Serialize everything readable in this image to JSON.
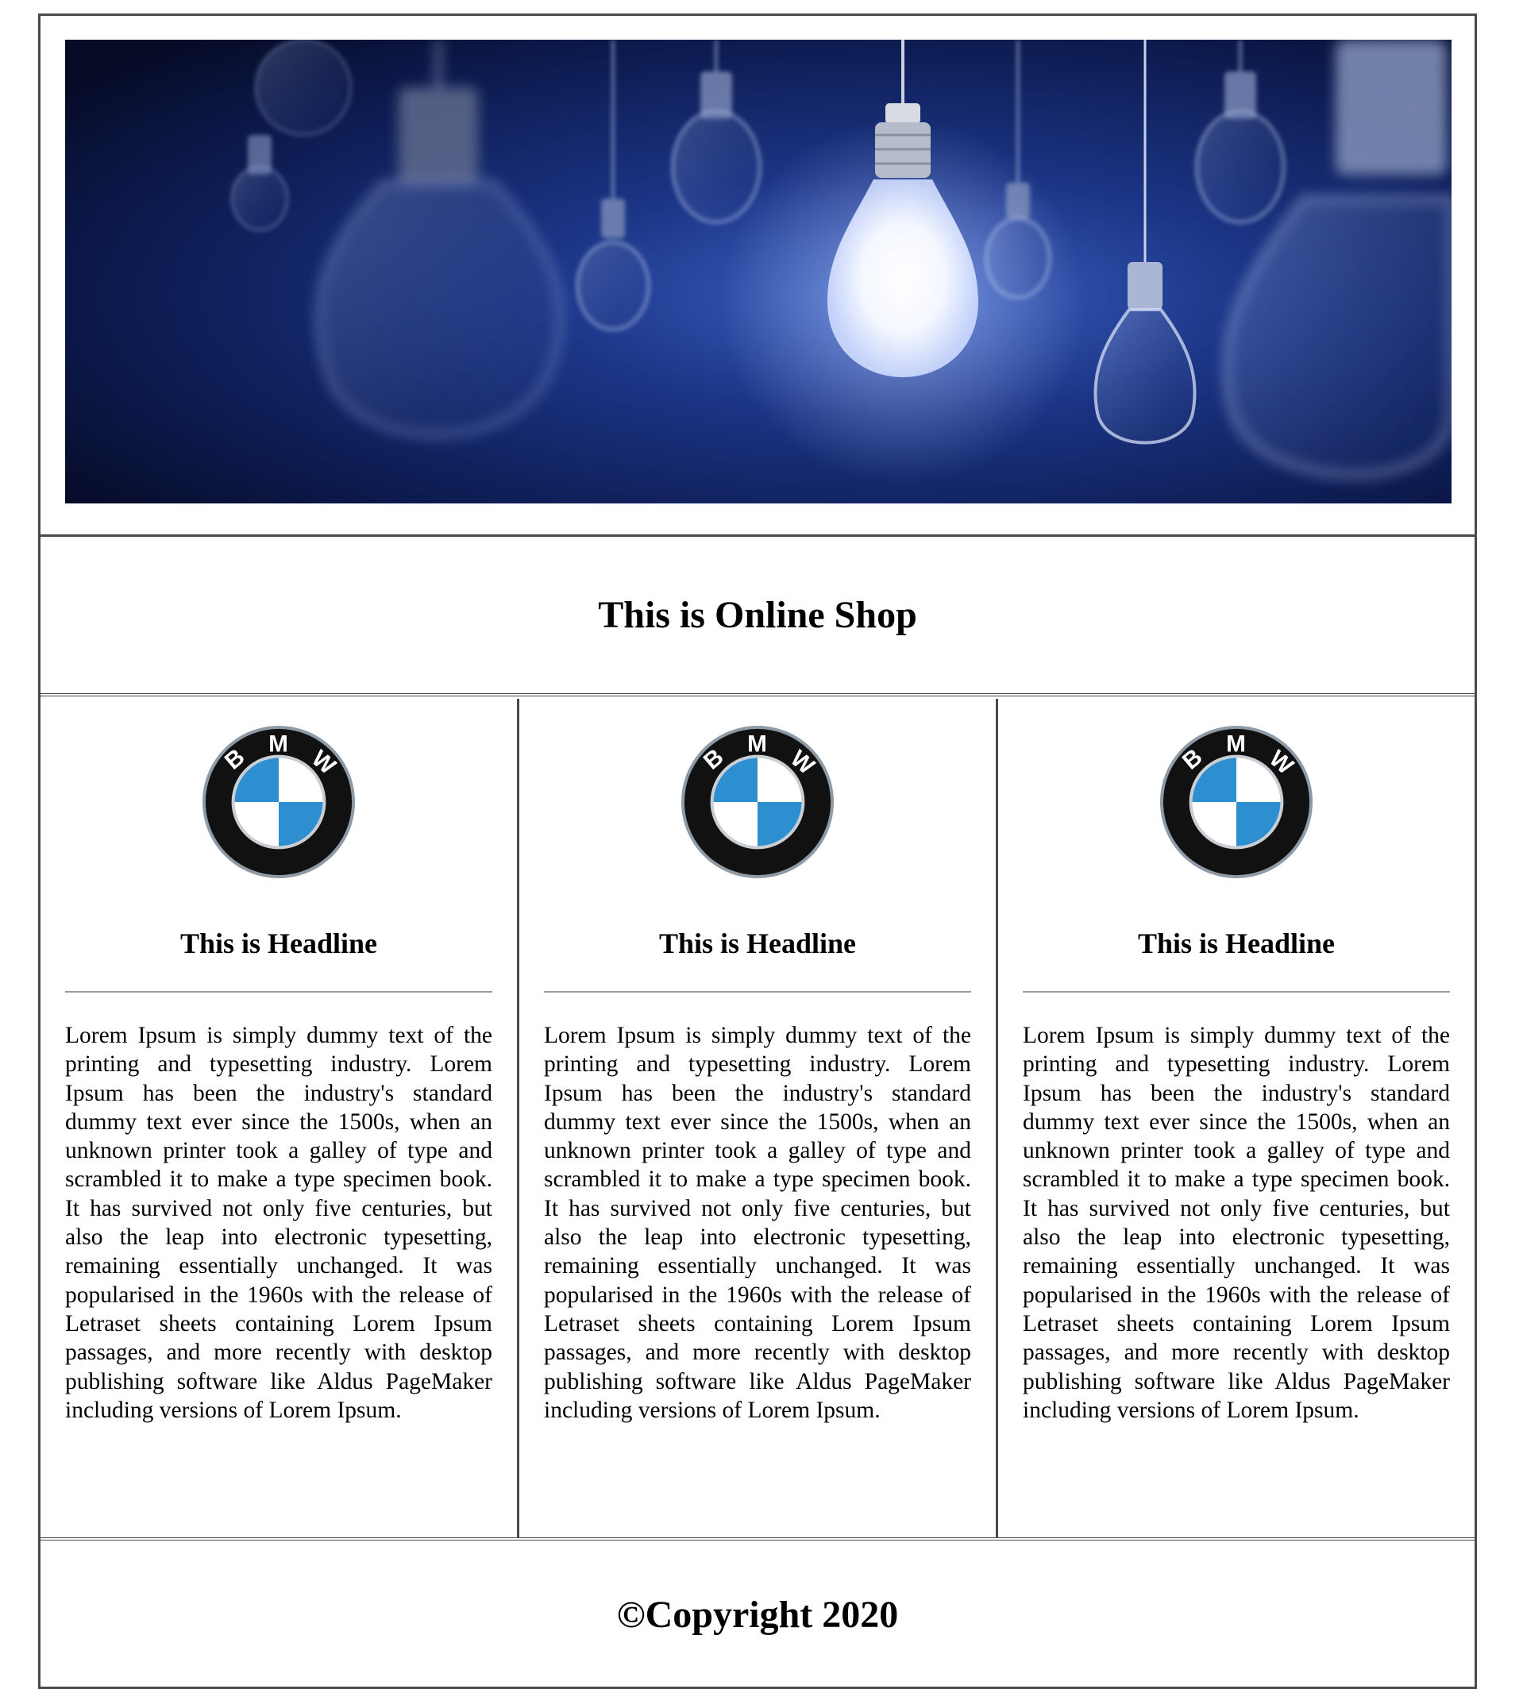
{
  "header": {
    "banner_image": "hanging-light-bulbs-banner"
  },
  "shop": {
    "title": "This is Online Shop"
  },
  "cards": [
    {
      "logo": "bmw-logo",
      "logo_letters": [
        "B",
        "M",
        "W"
      ],
      "headline": "This is Headline",
      "body": "Lorem Ipsum is simply dummy text of the printing and typesetting industry. Lorem Ipsum has been the industry's standard dummy text ever since the 1500s, when an unknown printer took a galley of type and scrambled it to make a type specimen book. It has survived not only five centuries, but also the leap into electronic typesetting, remaining essentially unchanged. It was popularised in the 1960s with the release of Letraset sheets containing Lorem Ipsum passages, and more recently with desktop publishing software like Aldus PageMaker including versions of Lorem Ipsum."
    },
    {
      "logo": "bmw-logo",
      "logo_letters": [
        "B",
        "M",
        "W"
      ],
      "headline": "This is Headline",
      "body": "Lorem Ipsum is simply dummy text of the printing and typesetting industry. Lorem Ipsum has been the industry's standard dummy text ever since the 1500s, when an unknown printer took a galley of type and scrambled it to make a type specimen book. It has survived not only five centuries, but also the leap into electronic typesetting, remaining essentially unchanged. It was popularised in the 1960s with the release of Letraset sheets containing Lorem Ipsum passages, and more recently with desktop publishing software like Aldus PageMaker including versions of Lorem Ipsum."
    },
    {
      "logo": "bmw-logo",
      "logo_letters": [
        "B",
        "M",
        "W"
      ],
      "headline": "This is Headline",
      "body": "Lorem Ipsum is simply dummy text of the printing and typesetting industry. Lorem Ipsum has been the industry's standard dummy text ever since the 1500s, when an unknown printer took a galley of type and scrambled it to make a type specimen book. It has survived not only five centuries, but also the leap into electronic typesetting, remaining essentially unchanged. It was popularised in the 1960s with the release of Letraset sheets containing Lorem Ipsum passages, and more recently with desktop publishing software like Aldus PageMaker including versions of Lorem Ipsum."
    }
  ],
  "footer": {
    "copyright": "©Copyright 2020"
  },
  "colors": {
    "border": "#4a4a4a",
    "divider": "#9a9a9a",
    "banner_dark": "#0b1436",
    "banner_mid": "#1f3a8a",
    "bmw_blue": "#2e8fd0"
  }
}
